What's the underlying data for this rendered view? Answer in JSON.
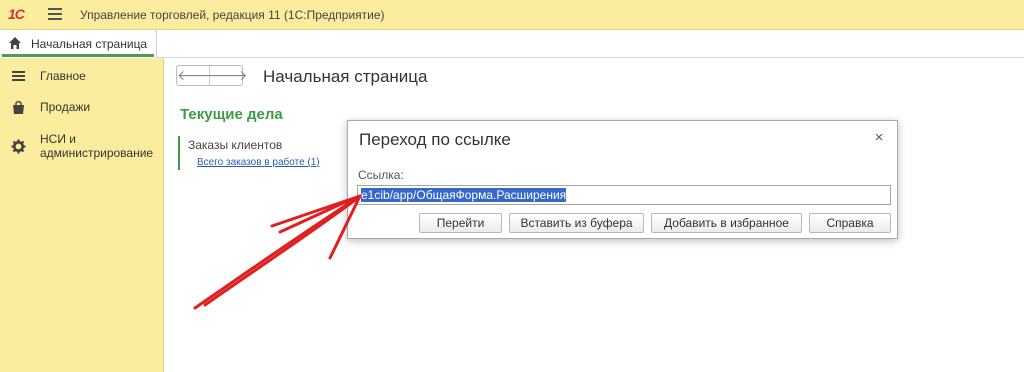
{
  "window": {
    "logo_text": "1С",
    "title": "Управление торговлей, редакция 11  (1С:Предприятие)"
  },
  "tabs": {
    "home_label": "Начальная страница"
  },
  "sidebar": {
    "items": [
      {
        "label": "Главное",
        "icon": "menu-lines-icon"
      },
      {
        "label": "Продажи",
        "icon": "shopping-bag-icon"
      },
      {
        "label": "НСИ и администрирование",
        "icon": "gear-icon"
      }
    ]
  },
  "page": {
    "title": "Начальная страница",
    "nav_back": "🡐",
    "nav_forward": "🡒",
    "section_title": "Текущие дела",
    "task_label": "Заказы клиентов",
    "task_link": "Всего заказов в работе (1)"
  },
  "dialog": {
    "title": "Переход по ссылке",
    "close_glyph": "×",
    "field_label": "Ссылка:",
    "field_value": "e1cib/app/ОбщаяФорма.Расширения",
    "buttons": {
      "go": "Перейти",
      "paste": "Вставить из буфера",
      "favorite": "Добавить в избранное",
      "help": "Справка"
    }
  },
  "colors": {
    "panel_yellow": "#fbed9e",
    "accent_green": "#3c9c44",
    "link_blue": "#2a5fb0",
    "selection_blue": "#3568c9",
    "annotation_red": "#e02020"
  }
}
